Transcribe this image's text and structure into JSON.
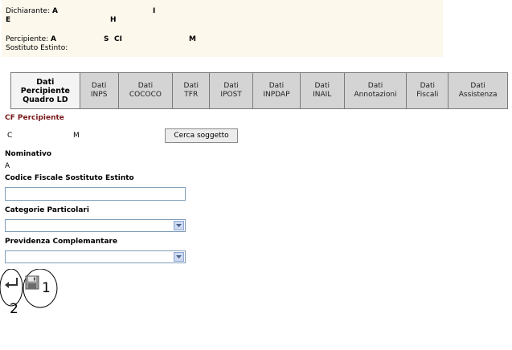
{
  "header": {
    "dichiarante_label": "Dichiarante:",
    "dichiarante_value": "A",
    "dichiarante_tail": "I",
    "line2_start": "E",
    "line2_end": "H",
    "percipiente_label": "Percipiente:",
    "percipiente_value": "A",
    "percipiente_mid1": "S",
    "percipiente_mid2": "CI",
    "percipiente_tail": "M",
    "sostituto_label": "Sostituto Estinto:"
  },
  "tabs": [
    {
      "label": "Dati\nPercipiente\nQuadro LD",
      "active": true
    },
    {
      "label": "Dati\nINPS",
      "active": false
    },
    {
      "label": "Dati\nCOCOCO",
      "active": false
    },
    {
      "label": "Dati\nTFR",
      "active": false
    },
    {
      "label": "Dati\nIPOST",
      "active": false
    },
    {
      "label": "Dati\nINPDAP",
      "active": false
    },
    {
      "label": "Dati\nINAIL",
      "active": false
    },
    {
      "label": "Dati\nAnnotazioni",
      "active": false
    },
    {
      "label": "Dati\nFiscali",
      "active": false
    },
    {
      "label": "Dati\nAssistenza",
      "active": false
    }
  ],
  "form": {
    "cf_label": "CF Percipiente",
    "cf_value_start": "C",
    "cf_value_end": "M",
    "cerca_button": "Cerca soggetto",
    "nominativo_label": "Nominativo",
    "nominativo_value": "A",
    "codice_fiscale_label": "Codice Fiscale Sostituto Estinto",
    "codice_fiscale_value": "",
    "categorie_label": "Categorie Particolari",
    "categorie_selected": "",
    "previdenza_label": "Previdenza Complemantare",
    "previdenza_selected": ""
  },
  "annotations": {
    "marker_1": "1",
    "marker_2": "2"
  },
  "icons": [
    "back-arrow-icon",
    "save-disk-icon",
    "chevron-down-icon"
  ],
  "colors": {
    "header_bg": "#fdf8ec",
    "tab_bg": "#d4d4d4",
    "active_tab_bg": "#f4f4f4",
    "cf_label": "#7a1a1a",
    "input_border": "#7f9db9"
  }
}
